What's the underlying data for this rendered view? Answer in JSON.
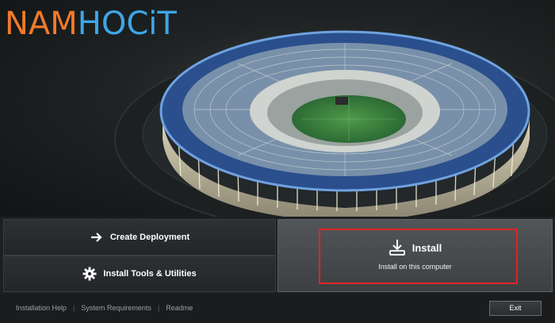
{
  "watermark": {
    "part1": "NAM",
    "part2": "HOCiT"
  },
  "hero": {
    "image": "stadium-illustration"
  },
  "actions": {
    "create_deployment": {
      "label": "Create Deployment",
      "icon": "arrow-right-icon"
    },
    "install_tools": {
      "label": "Install Tools & Utilities",
      "icon": "gear-icon"
    },
    "install": {
      "label": "Install",
      "sublabel": "Install on this computer",
      "icon": "download-tray-icon"
    }
  },
  "footer": {
    "links": [
      "Installation Help",
      "System Requirements",
      "Readme"
    ],
    "exit_label": "Exit"
  },
  "colors": {
    "highlight": "#e02424",
    "watermark_orange": "#f07a2a",
    "watermark_blue": "#3ea6e6"
  }
}
